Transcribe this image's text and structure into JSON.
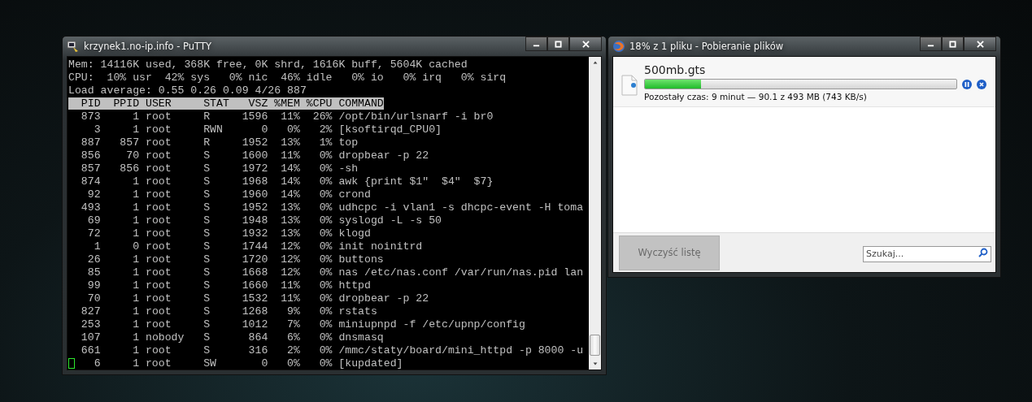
{
  "putty": {
    "title": "krzynek1.no-ip.info - PuTTY",
    "summary": [
      "Mem: 14116K used, 368K free, 0K shrd, 1616K buff, 5604K cached",
      "CPU:  10% usr  42% sys   0% nic  46% idle   0% io   0% irq   0% sirq",
      "Load average: 0.55 0.26 0.09 4/26 887"
    ],
    "header": "  PID  PPID USER     STAT   VSZ %MEM %CPU COMMAND",
    "rows": [
      "  873     1 root     R     1596  11%  26% /opt/bin/urlsnarf -i br0",
      "    3     1 root     RWN      0   0%   2% [ksoftirqd_CPU0]",
      "  887   857 root     R     1952  13%   1% top",
      "  856    70 root     S     1600  11%   0% dropbear -p 22",
      "  857   856 root     S     1972  14%   0% -sh",
      "  874     1 root     S     1968  14%   0% awk {print $1\"  $4\"  $7}",
      "   92     1 root     S     1960  14%   0% crond",
      "  493     1 root     S     1952  13%   0% udhcpc -i vlan1 -s dhcpc-event -H toma",
      "   69     1 root     S     1948  13%   0% syslogd -L -s 50",
      "   72     1 root     S     1932  13%   0% klogd",
      "    1     0 root     S     1744  12%   0% init noinitrd",
      "   26     1 root     S     1720  12%   0% buttons",
      "   85     1 root     S     1668  12%   0% nas /etc/nas.conf /var/run/nas.pid lan",
      "   99     1 root     S     1660  11%   0% httpd",
      "   70     1 root     S     1532  11%   0% dropbear -p 22",
      "  827     1 root     S     1268   9%   0% rstats",
      "  253     1 root     S     1012   7%   0% miniupnpd -f /etc/upnp/config",
      "  107     1 nobody   S      864   6%   0% dnsmasq",
      "  661     1 root     S      316   2%   0% /mmc/staty/board/mini_httpd -p 8000 -u",
      "   6     1 root     SW       0   0%   0% [kupdated]"
    ]
  },
  "downloads": {
    "title": "18% z 1 pliku - Pobieranie plików",
    "items": [
      {
        "name": "500mb.gts",
        "level": 0.18,
        "status": "Pozostały czas: 9 minut — 90.1 z 493 MB (743 KB/s)"
      }
    ],
    "clear_button": {
      "label": "Wyczyść listę",
      "disabled": true
    },
    "search": {
      "placeholder": "Szukaj..."
    }
  }
}
